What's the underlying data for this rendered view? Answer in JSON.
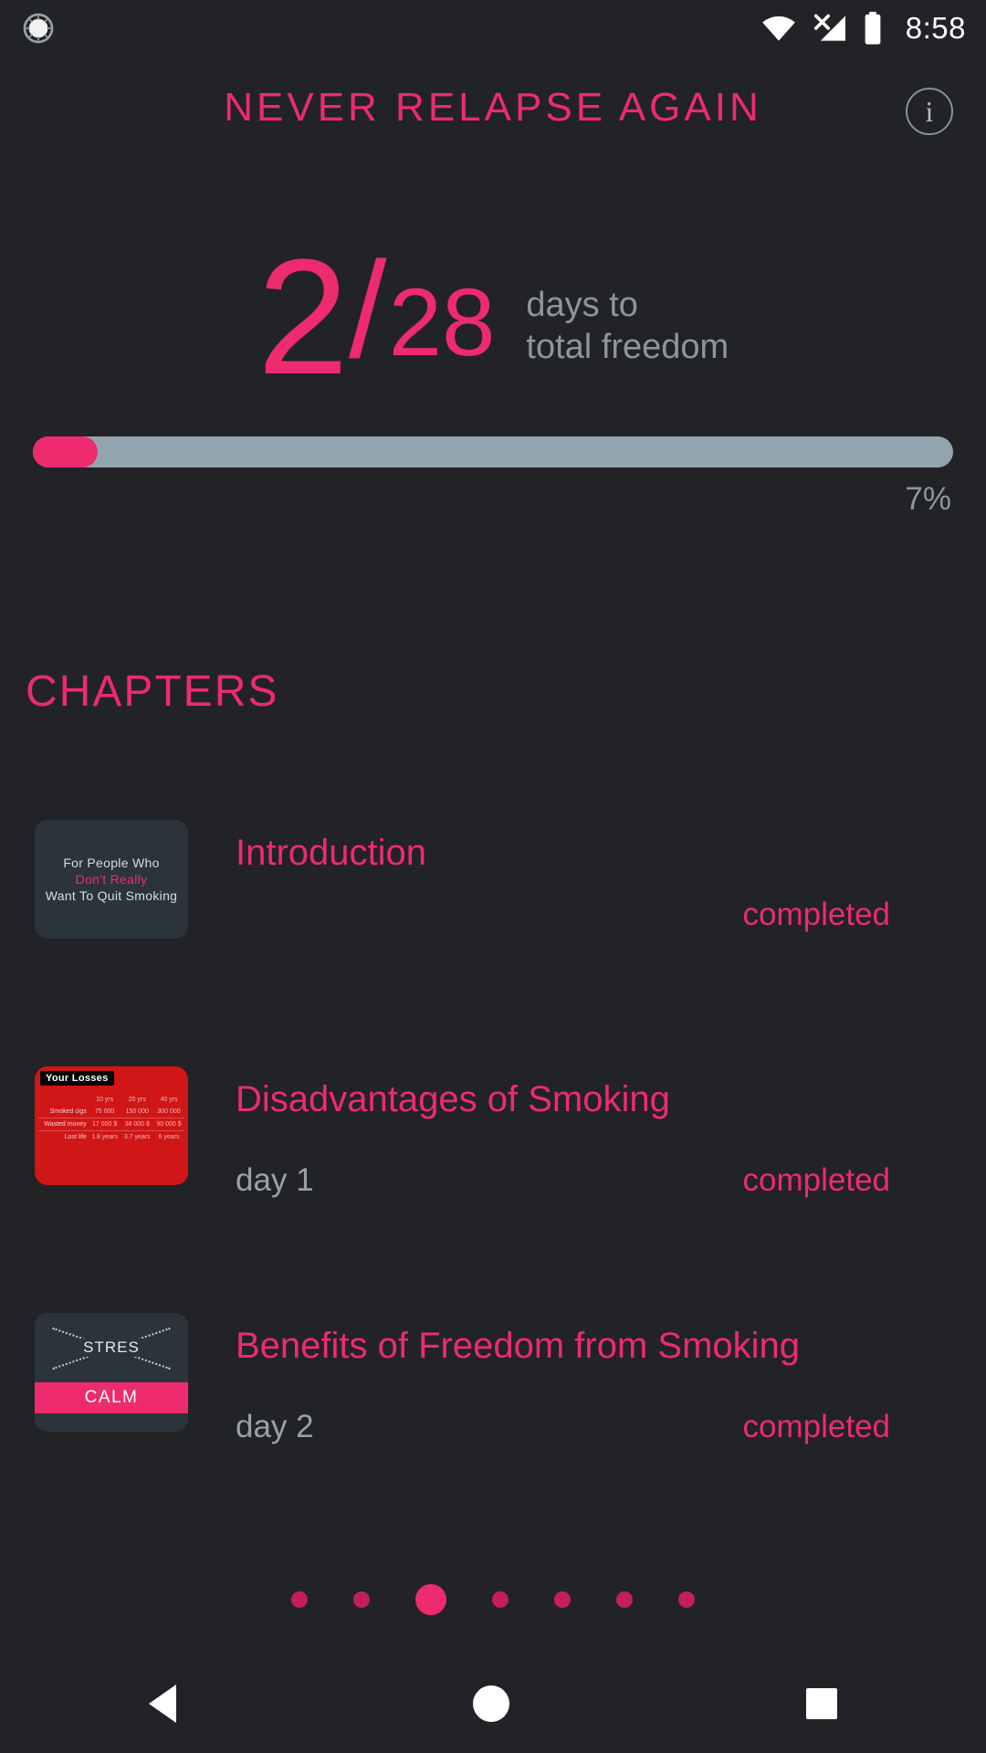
{
  "status_bar": {
    "time": "8:58",
    "icons": [
      "alarm-icon",
      "wifi-icon",
      "cellular-signal-off-icon",
      "battery-icon"
    ]
  },
  "header": {
    "title": "NEVER RELAPSE AGAIN",
    "info_label": "i",
    "accent_color": "#ed2b6e"
  },
  "counter": {
    "current": "2",
    "separator": "/",
    "total": "28",
    "label_line1": "days to",
    "label_line2": "total freedom"
  },
  "progress": {
    "percent_label": "7%",
    "percent_value": 7,
    "track_color": "#94a4af",
    "fill_color": "#ed2b6e"
  },
  "chapters_section": {
    "heading": "CHAPTERS",
    "items": [
      {
        "title": "Introduction",
        "day": "",
        "status": "completed",
        "thumb": {
          "kind": "intro-card",
          "line1": "For People Who",
          "line2": "Don't Really",
          "line3": "Want To Quit Smoking"
        }
      },
      {
        "title": "Disadvantages of Smoking",
        "day": "day 1",
        "status": "completed",
        "thumb": {
          "kind": "losses-table",
          "badge": "Your Losses",
          "columns": [
            "10 yrs",
            "20 yrs",
            "40 yrs"
          ],
          "rows": [
            {
              "label": "Smoked cigs",
              "values": [
                "75 000",
                "150 000",
                "300 000"
              ]
            },
            {
              "label": "Wasted money",
              "values": [
                "17 000 $",
                "38 000 $",
                "90 000 $"
              ]
            },
            {
              "label": "Lost life",
              "values": [
                "1.8 years",
                "3.7 years",
                "6 years"
              ]
            }
          ]
        }
      },
      {
        "title": "Benefits of Freedom from Smoking",
        "day": "day 2",
        "status": "completed",
        "thumb": {
          "kind": "stress-calm-card",
          "crossed_word": "STRES",
          "band_word": "CALM"
        }
      }
    ]
  },
  "pagination": {
    "count": 7,
    "active_index": 2
  },
  "nav_bar": {
    "back_label": "back-triangle",
    "home_label": "home-circle",
    "recents_label": "recents-square"
  }
}
